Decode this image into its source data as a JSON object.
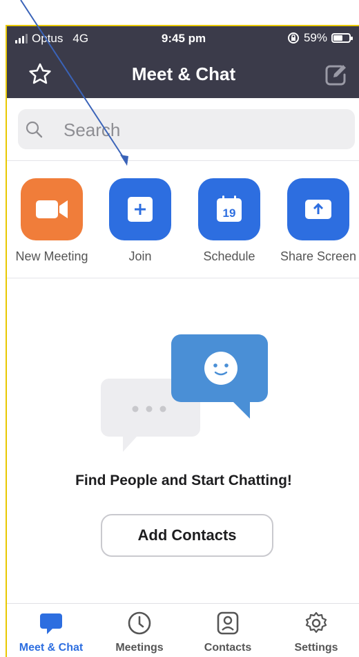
{
  "status_bar": {
    "carrier": "Optus",
    "network": "4G",
    "time": "9:45 pm",
    "battery": "59%",
    "battery_level": 0.59
  },
  "header": {
    "title": "Meet & Chat",
    "left_icon": "star-icon",
    "right_icon": "edit-icon"
  },
  "search": {
    "placeholder": "Search"
  },
  "actions": [
    {
      "label": "New Meeting",
      "icon": "video-camera-icon",
      "color": "#f07d3a"
    },
    {
      "label": "Join",
      "icon": "plus-icon",
      "color": "#2d6ee0"
    },
    {
      "label": "Schedule",
      "icon": "calendar-icon",
      "color": "#2d6ee0",
      "calendar_day": "19"
    },
    {
      "label": "Share Screen",
      "icon": "upload-arrow-icon",
      "color": "#2d6ee0"
    }
  ],
  "empty_state": {
    "title": "Find People and Start Chatting!",
    "button": "Add Contacts"
  },
  "tabs": [
    {
      "label": "Meet & Chat",
      "icon": "chat-bubble-icon",
      "active": true
    },
    {
      "label": "Meetings",
      "icon": "clock-icon",
      "active": false
    },
    {
      "label": "Contacts",
      "icon": "contact-card-icon",
      "active": false
    },
    {
      "label": "Settings",
      "icon": "gear-icon",
      "active": false
    }
  ],
  "colors": {
    "header_bg": "#3b3b4a",
    "accent_blue": "#2d6ee0",
    "accent_orange": "#f07d3a",
    "annotation_arrow": "#3a63b8"
  }
}
